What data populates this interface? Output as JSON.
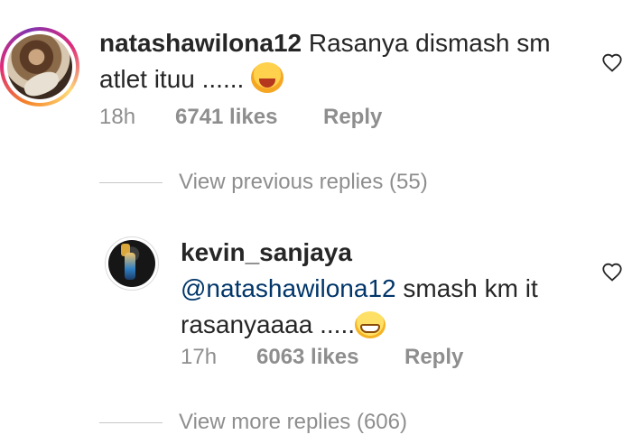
{
  "comments": [
    {
      "username": "natashawilona12",
      "text_line1": "Rasanya dismash sm",
      "text_line2": "atlet ituu ......",
      "emoji": "tired-face-icon",
      "time": "18h",
      "likes": "6741 likes",
      "reply_label": "Reply"
    },
    {
      "username": "kevin_sanjaya",
      "mention": "@natashawilona12",
      "text_line1": "smash km it",
      "text_line2": "rasanyaaaa .....",
      "emoji": "grinning-face-icon",
      "time": "17h",
      "likes": "6063 likes",
      "reply_label": "Reply"
    }
  ],
  "view_previous": "View previous replies (55)",
  "view_more": "View more replies (606)",
  "icons": {
    "like": "heart-outline-icon"
  },
  "colors": {
    "text": "#262626",
    "secondary": "#8e8e8e",
    "mention": "#003569"
  }
}
